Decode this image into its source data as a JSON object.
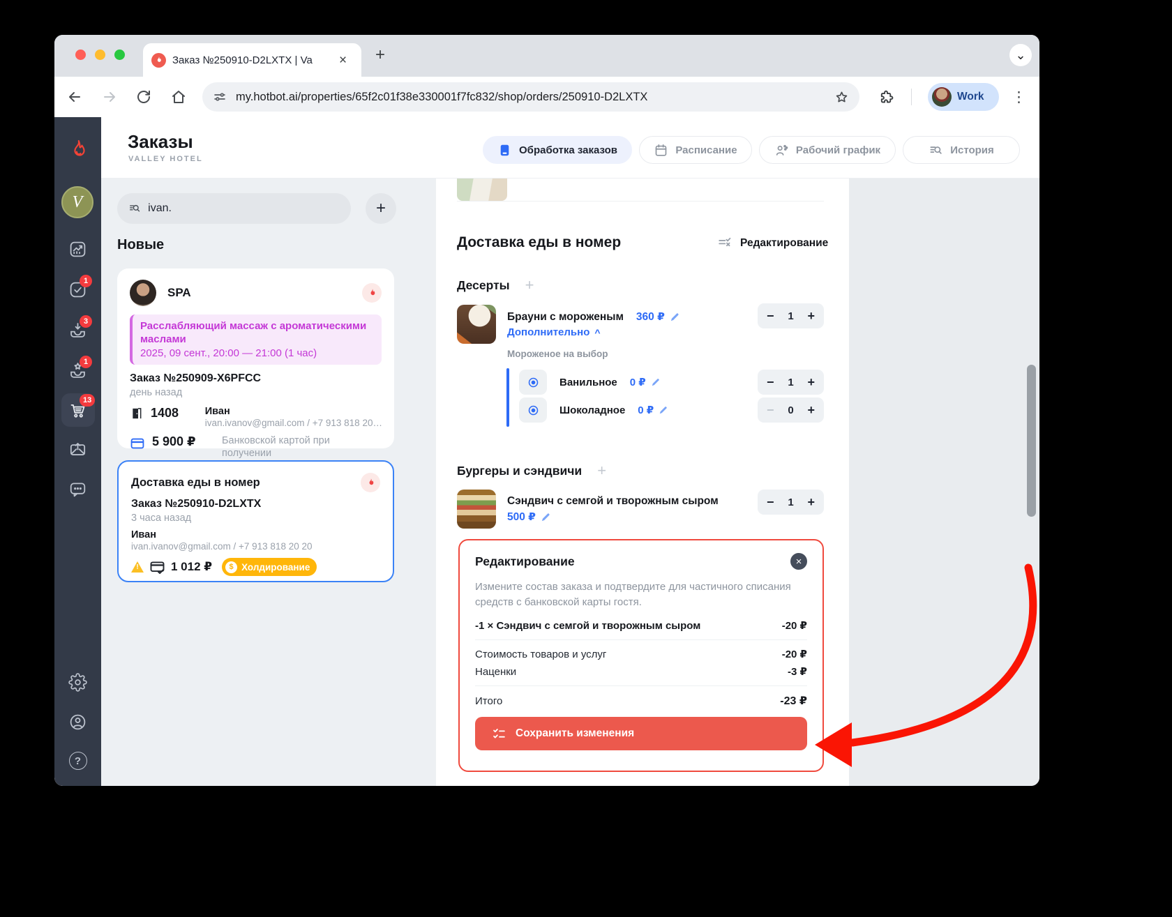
{
  "browser": {
    "tab_title": "Заказ №250910-D2LXTX | Va",
    "url": "my.hotbot.ai/properties/65f2c01f38e330001f7fc832/shop/orders/250910-D2LXTX",
    "profile_label": "Work"
  },
  "icons": {
    "new_tab": "+",
    "tab_close": "×",
    "window_chevron": "⌄",
    "menu_kebab": "⋮",
    "add": "+",
    "minus": "−",
    "plus": "+",
    "chevron_up": "^",
    "panel_close": "×",
    "help": "?",
    "warning": "!",
    "coin": "$"
  },
  "sidebar": {
    "logo_monogram": "V",
    "badges": {
      "tasks": "1",
      "inbox": "3",
      "featured": "1",
      "cart": "13"
    }
  },
  "header": {
    "title": "Заказы",
    "subtitle": "VALLEY HOTEL",
    "nav": [
      {
        "label": "Обработка заказов"
      },
      {
        "label": "Расписание"
      },
      {
        "label": "Рабочий график"
      },
      {
        "label": "История"
      }
    ]
  },
  "orders_panel": {
    "search_value": "ivan.",
    "section_title": "Новые",
    "spa_card": {
      "vendor": "SPA",
      "service_title": "Расслабляющий массаж с ароматическими маслами",
      "service_time": "2025, 09 сент., 20:00 — 21:00  (1 час)",
      "order_no": "Заказ №250909-X6PFCC",
      "time_ago": "день назад",
      "room": "1408",
      "guest_name": "Иван",
      "guest_contacts": "ivan.ivanov@gmail.com / +7 913 818 20…",
      "amount": "5 900 ₽",
      "payment_method": "Банковской картой при получении"
    },
    "food_card": {
      "title": "Доставка еды в номер",
      "order_no": "Заказ №250910-D2LXTX",
      "time_ago": "3 часа назад",
      "guest_name": "Иван",
      "guest_contacts": "ivan.ivanov@gmail.com / +7 913 818 20 20",
      "amount": "1 012 ₽",
      "status": "Холдирование"
    }
  },
  "order_view": {
    "title": "Доставка еды в номер",
    "edit_action": "Редактирование",
    "dessert_section": "Десерты",
    "burger_section": "Бургеры и сэндвичи",
    "brownie": {
      "name": "Брауни с мороженым",
      "price": "360 ₽",
      "more": "Дополнительно",
      "qty": "1"
    },
    "options_group": "Мороженое на выбор",
    "options": [
      {
        "name": "Ванильное",
        "price": "0 ₽",
        "qty": "1"
      },
      {
        "name": "Шоколадное",
        "price": "0 ₽",
        "qty": "0"
      }
    ],
    "sandwich": {
      "name": "Сэндвич с семгой и творожным сыром",
      "price": "500 ₽",
      "qty": "1"
    }
  },
  "edit_panel": {
    "title": "Редактирование",
    "description": "Измените состав заказа и подтвердите для частичного списания средств с банковской карты гостя.",
    "item_qty": "-1 ×",
    "item_name": "Сэндвич с семгой и творожным сыром",
    "item_amount": "-20 ₽",
    "rows": [
      {
        "label": "Стоимость товаров и услуг",
        "amount": "-20 ₽"
      },
      {
        "label": "Наценки",
        "amount": "-3 ₽"
      }
    ],
    "total_label": "Итого",
    "total_amount": "-23 ₽",
    "save_label": "Сохранить изменения"
  }
}
